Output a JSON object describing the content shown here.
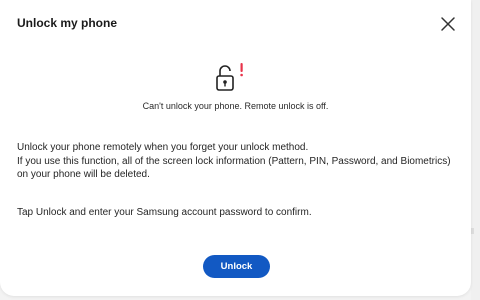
{
  "dialog": {
    "title": "Unlock my phone",
    "status_text": "Can't unlock your phone. Remote unlock is off.",
    "description_line1": "Unlock your phone remotely when you forget your unlock method.",
    "description_line2": "If you use this function, all of the screen lock information (Pattern, PIN, Password, and Biometrics) on your phone will be deleted.",
    "confirm_text": "Tap Unlock and enter your Samsung account password to confirm.",
    "unlock_label": "Unlock",
    "close_icon": "close-icon",
    "status_icon": "unlocked-padlock-warning-icon"
  },
  "colors": {
    "accent": "#1259c3",
    "warning": "#e8334a",
    "text": "#252525"
  }
}
